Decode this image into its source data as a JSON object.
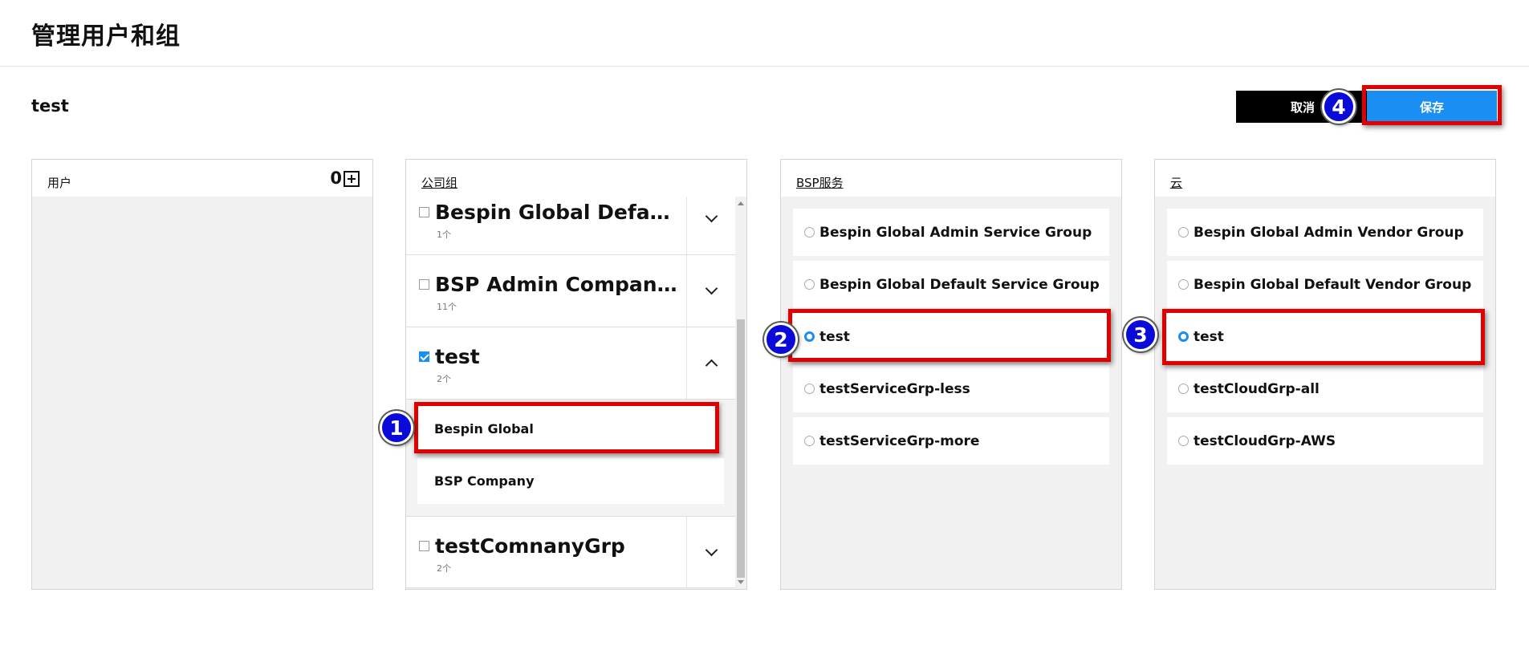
{
  "page": {
    "title": "管理用户和组",
    "subtitle": "test"
  },
  "actions": {
    "cancel_label": "取消",
    "save_label": "保存"
  },
  "users_panel": {
    "label": "用户",
    "count": "0"
  },
  "company_panel": {
    "label": "公司组",
    "groups": [
      {
        "name": "Bespin Global Default G…",
        "count": "1个",
        "checked": false,
        "expanded": false
      },
      {
        "name": "BSP Admin Company Gr…",
        "count": "11个",
        "checked": false,
        "expanded": false
      },
      {
        "name": "test",
        "count": "2个",
        "checked": true,
        "expanded": true,
        "members": [
          "Bespin Global",
          "BSP Company"
        ]
      },
      {
        "name": "testComnanyGrp",
        "count": "2个",
        "checked": false,
        "expanded": false
      }
    ]
  },
  "service_panel": {
    "label": "BSP服务",
    "items": [
      {
        "label": "Bespin Global Admin Service Group",
        "selected": false
      },
      {
        "label": "Bespin Global Default Service Group",
        "selected": false
      },
      {
        "label": "test",
        "selected": true
      },
      {
        "label": "testServiceGrp-less",
        "selected": false
      },
      {
        "label": "testServiceGrp-more",
        "selected": false
      }
    ]
  },
  "cloud_panel": {
    "label": "云",
    "items": [
      {
        "label": "Bespin Global Admin Vendor Group",
        "selected": false
      },
      {
        "label": "Bespin Global Default Vendor Group",
        "selected": false
      },
      {
        "label": "test",
        "selected": true
      },
      {
        "label": "testCloudGrp-all",
        "selected": false
      },
      {
        "label": "testCloudGrp-AWS",
        "selected": false
      }
    ]
  },
  "annotations": [
    "1",
    "2",
    "3",
    "4"
  ],
  "colors": {
    "accent": "#1a8ef3",
    "highlight": "#e00000",
    "badge": "#0b0bd9"
  }
}
